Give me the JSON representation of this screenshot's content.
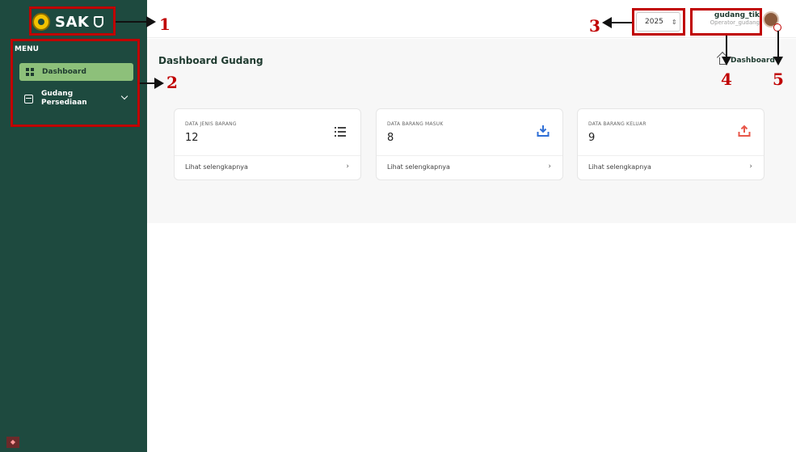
{
  "brand": {
    "name": "SAK"
  },
  "sidebar": {
    "menu_label": "MENU",
    "items": [
      {
        "label": "Dashboard"
      },
      {
        "label_line1": "Gudang",
        "label_line2": "Persediaan"
      }
    ]
  },
  "topbar": {
    "year": "2025",
    "user": {
      "name": "gudang_tik",
      "role": "Operator_gudang"
    }
  },
  "main": {
    "title": "Dashboard Gudang",
    "breadcrumb": "Dashboard",
    "cards": [
      {
        "label": "DATA JENIS BARANG",
        "value": "12",
        "link": "Lihat selengkapnya",
        "icon": "list-icon",
        "color": "#444444"
      },
      {
        "label": "DATA BARANG MASUK",
        "value": "8",
        "link": "Lihat selengkapnya",
        "icon": "download-icon",
        "color": "#2f6fd6"
      },
      {
        "label": "DATA BARANG KELUAR",
        "value": "9",
        "link": "Lihat selengkapnya",
        "icon": "upload-icon",
        "color": "#e8574a"
      }
    ]
  },
  "annotations": [
    "1",
    "2",
    "3",
    "4",
    "5"
  ],
  "colors": {
    "sidebar_bg": "#1e4a3f",
    "active_item": "#8dc07a",
    "annotation": "#c00000"
  }
}
